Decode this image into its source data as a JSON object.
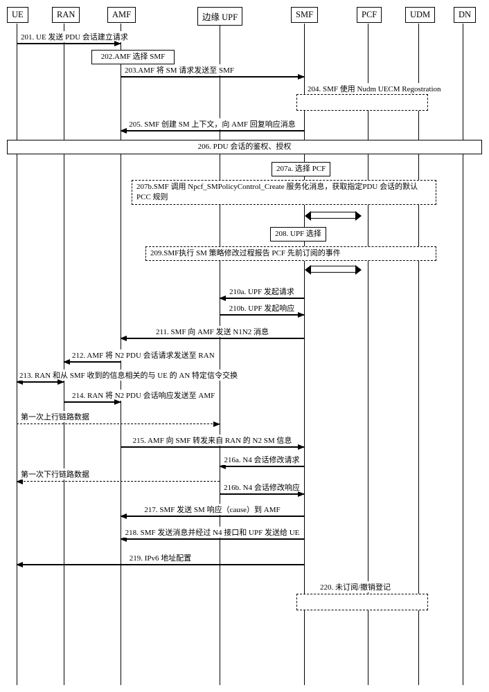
{
  "actors": {
    "ue": "UE",
    "ran": "RAN",
    "amf": "AMF",
    "edgeupf": "边缘 UPF",
    "smf": "SMF",
    "pcf": "PCF",
    "udm": "UDM",
    "dn": "DN"
  },
  "steps": {
    "s201": "201. UE 发送 PDU 会话建立请求",
    "s202": "202.AMF 选择 SMF",
    "s203": "203.AMF 将 SM 请求发送至 SMF",
    "s204": "204. SMF 使用 Nudm UECM Regostration",
    "s205": "205. SMF 创建 SM 上下文，向 AMF 回复响应消息",
    "s206": "206. PDU 会话的鉴权、授权",
    "s207a": "207a. 选择 PCF",
    "s207b": "207b.SMF 调用 Npcf_SMPolicyControl_Create 服务化消息，获取指定PDU 会话的默认 PCC 规则",
    "s208": "208. UPF 选择",
    "s209": "209.SMF执行 SM 策略修改过程报告 PCF 先前订阅的事件",
    "s210a": "210a. UPF 发起请求",
    "s210b": "210b. UPF 发起响应",
    "s211": "211. SMF 向 AMF 发送 N1N2 消息",
    "s212": "212. AMF 将 N2 PDU 会话请求发送至 RAN",
    "s213": "213. RAN 和从 SMF 收到的信息相关的与 UE 的 AN 特定信令交换",
    "s214": "214. RAN 将 N2 PDU 会话响应发送至 AMF",
    "uplink": "第一次上行链路数据",
    "s215": "215. AMF 向 SMF 转发来自 RAN 的 N2 SM 信息",
    "s216a": "216a. N4 会话修改请求",
    "s216b": "216b. N4 会话修改响应",
    "downlink": "第一次下行链路数据",
    "s217": "217. SMF 发送 SM 响应（cause）到 AMF",
    "s218": "218. SMF 发送消息并经过 N4 接口和 UPF 发送给 UE",
    "s219": "219. IPv6 地址配置",
    "s220": "220. 未订阅/撤销登记"
  }
}
